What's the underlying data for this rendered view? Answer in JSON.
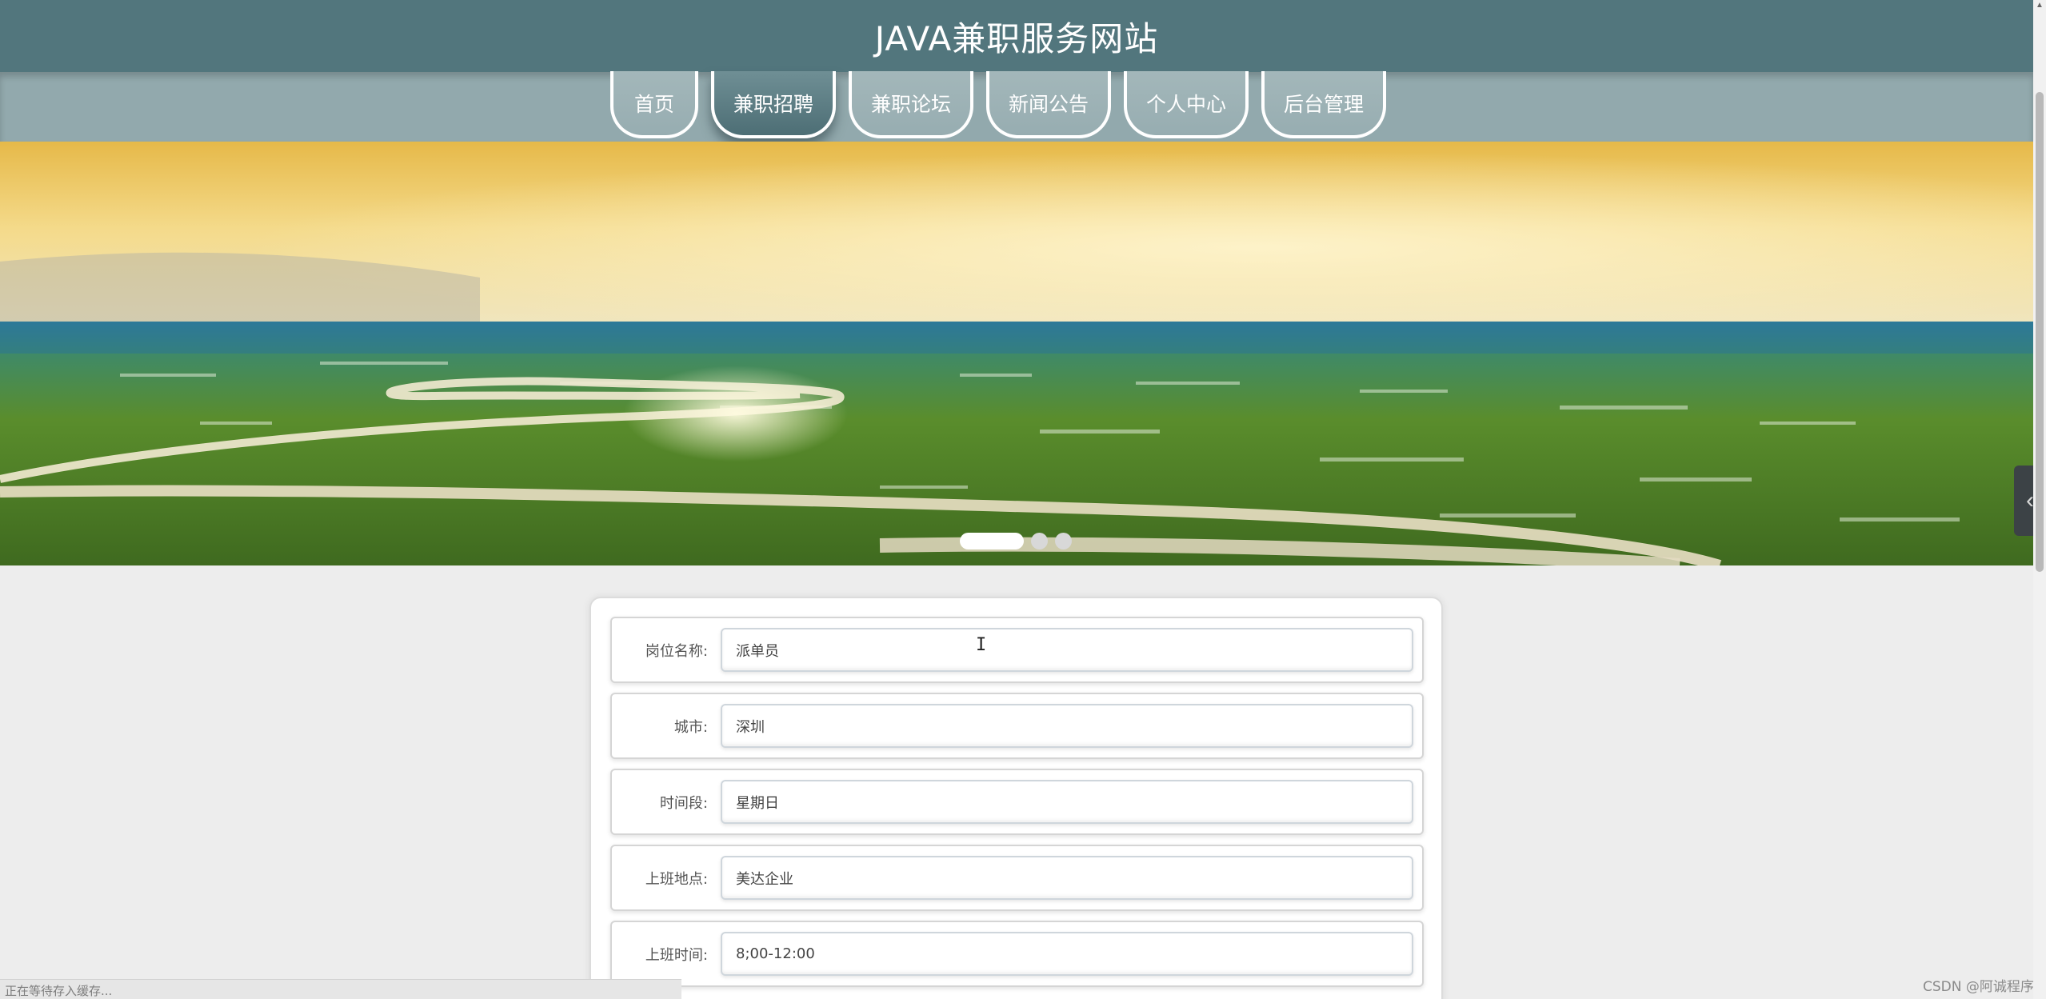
{
  "header": {
    "title": "JAVA兼职服务网站"
  },
  "nav": {
    "items": [
      {
        "label": "首页"
      },
      {
        "label": "兼职招聘"
      },
      {
        "label": "兼职论坛"
      },
      {
        "label": "新闻公告"
      },
      {
        "label": "个人中心"
      },
      {
        "label": "后台管理"
      }
    ],
    "active": "兼职招聘"
  },
  "banner": {
    "slide_count": 3,
    "active_slide": 1,
    "side_toggle_icon": "chevron-left-icon"
  },
  "form": {
    "fields": [
      {
        "label": "岗位名称:",
        "value": "派单员"
      },
      {
        "label": "城市:",
        "value": "深圳"
      },
      {
        "label": "时间段:",
        "value": "星期日"
      },
      {
        "label": "上班地点:",
        "value": "美达企业"
      },
      {
        "label": "上班时间:",
        "value": "8;00-12:00"
      }
    ]
  },
  "status": {
    "text": "正在等待存入缓存..."
  },
  "watermark": "CSDN @阿诚程序",
  "colors": {
    "header": "#52767d",
    "nav": "#92a9ad",
    "nav_active": "#4d6e75",
    "page_bg": "#ededed"
  }
}
